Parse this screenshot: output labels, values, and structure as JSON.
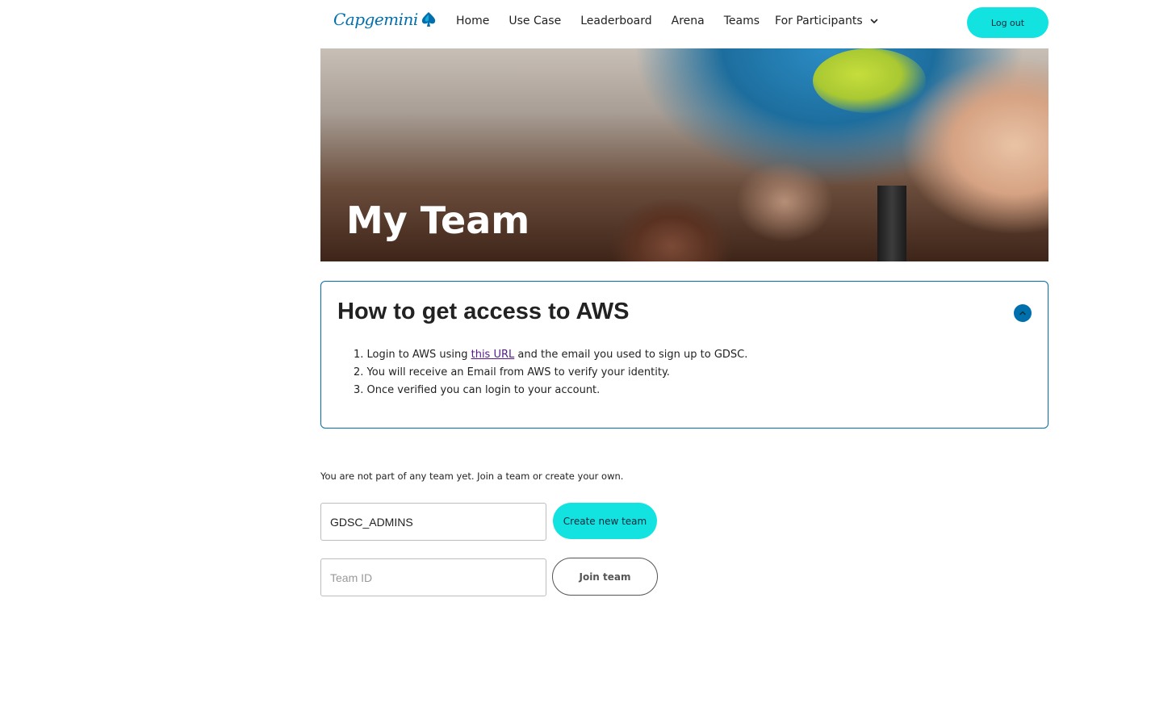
{
  "header": {
    "logo_text": "Capgemini",
    "nav": [
      {
        "label": "Home"
      },
      {
        "label": "Use Case"
      },
      {
        "label": "Leaderboard"
      },
      {
        "label": "Arena"
      },
      {
        "label": "Teams"
      }
    ],
    "dropdown_label": "For Participants",
    "logout_label": "Log out"
  },
  "hero": {
    "title": "My Team"
  },
  "aws_accordion": {
    "title": "How to get access to AWS",
    "expanded": true,
    "steps": [
      {
        "num": "1.",
        "before": "Login to AWS using ",
        "link": "this URL",
        "after": " and the email you used to sign up to GDSC."
      },
      {
        "num": "2.",
        "text": "You will receive an Email from AWS to verify your identity."
      },
      {
        "num": "3.",
        "text": "Once verified you can login to your account."
      }
    ]
  },
  "team": {
    "info_text": "You are not part of any team yet. Join a team or create your own.",
    "team_name_value": "GDSC_ADMINS",
    "create_label": "Create new team",
    "team_id_placeholder": "Team ID",
    "join_label": "Join team"
  },
  "colors": {
    "brand_blue": "#0070ad",
    "accent_cyan": "#12e3e1"
  }
}
